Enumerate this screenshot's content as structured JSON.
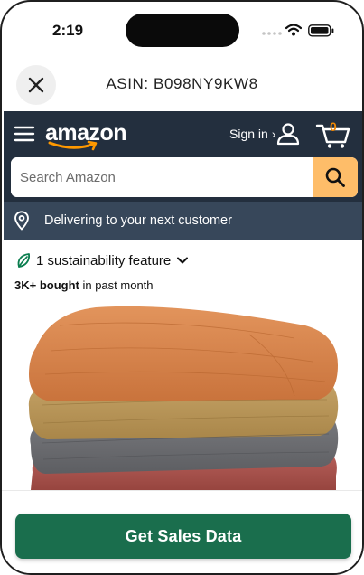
{
  "status_bar": {
    "time": "2:19"
  },
  "header": {
    "title": "ASIN: B098NY9KW8"
  },
  "amazon": {
    "logo_text": "amazon",
    "sign_in": "Sign in ›",
    "cart_count": "0",
    "search_placeholder": "Search Amazon",
    "delivery_text": "Delivering to your next customer"
  },
  "product": {
    "sustainability": "1 sustainability feature",
    "bought_bold": "3K+ bought",
    "bought_rest": " in past month"
  },
  "footer": {
    "cta_label": "Get Sales Data"
  },
  "colors": {
    "nav_bg": "#232f3e",
    "delivery_bg": "#37475a",
    "search_button": "#febd69",
    "cta_green": "#1a6e4d",
    "cart_count": "#f08804"
  }
}
